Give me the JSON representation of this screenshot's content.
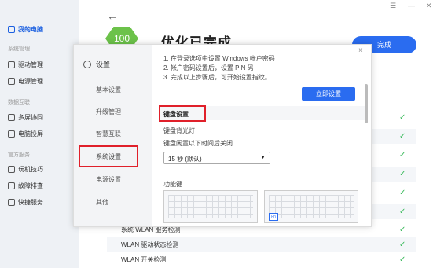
{
  "sidebar": {
    "my_pc": "我的电脑",
    "group_system": "系统管理",
    "driver": "驱动管理",
    "power": "电源管理",
    "group_interconnect": "数据互联",
    "multiscreen": "多屏协同",
    "projection": "电脑投屏",
    "group_service": "官方服务",
    "tips": "玩机技巧",
    "troubleshoot": "故障排查",
    "quick": "快捷服务"
  },
  "main": {
    "score": "100",
    "title": "优化已完成",
    "done_label": "完成",
    "rows": [
      "系统 WLAN 服务检测",
      "WLAN 驱动状态检测",
      "WLAN 开关检测"
    ]
  },
  "dialog": {
    "title": "设置",
    "nav": [
      "基本设置",
      "升级管理",
      "智慧互联",
      "系统设置",
      "电源设置",
      "其他"
    ],
    "selected_nav": "系统设置",
    "close": "×",
    "instructions": [
      "1. 在登录选项中设置 Windows 帐户密码",
      "2. 帐户密码设置后，设置 PIN 码",
      "3. 完成以上步骤后，可开始设置指纹。"
    ],
    "apply_label": "立即设置",
    "keyboard_section": "键盘设置",
    "backlight": "键盘背光灯",
    "idle_off": "键盘闲置以下时间后关闭",
    "timeout_value": "15 秒 (默认)",
    "fn_section": "功能键",
    "fn_key": "Fn"
  },
  "colors": {
    "accent": "#2a6cf0",
    "highlight": "#e0202a",
    "success": "#3dbb5e"
  }
}
